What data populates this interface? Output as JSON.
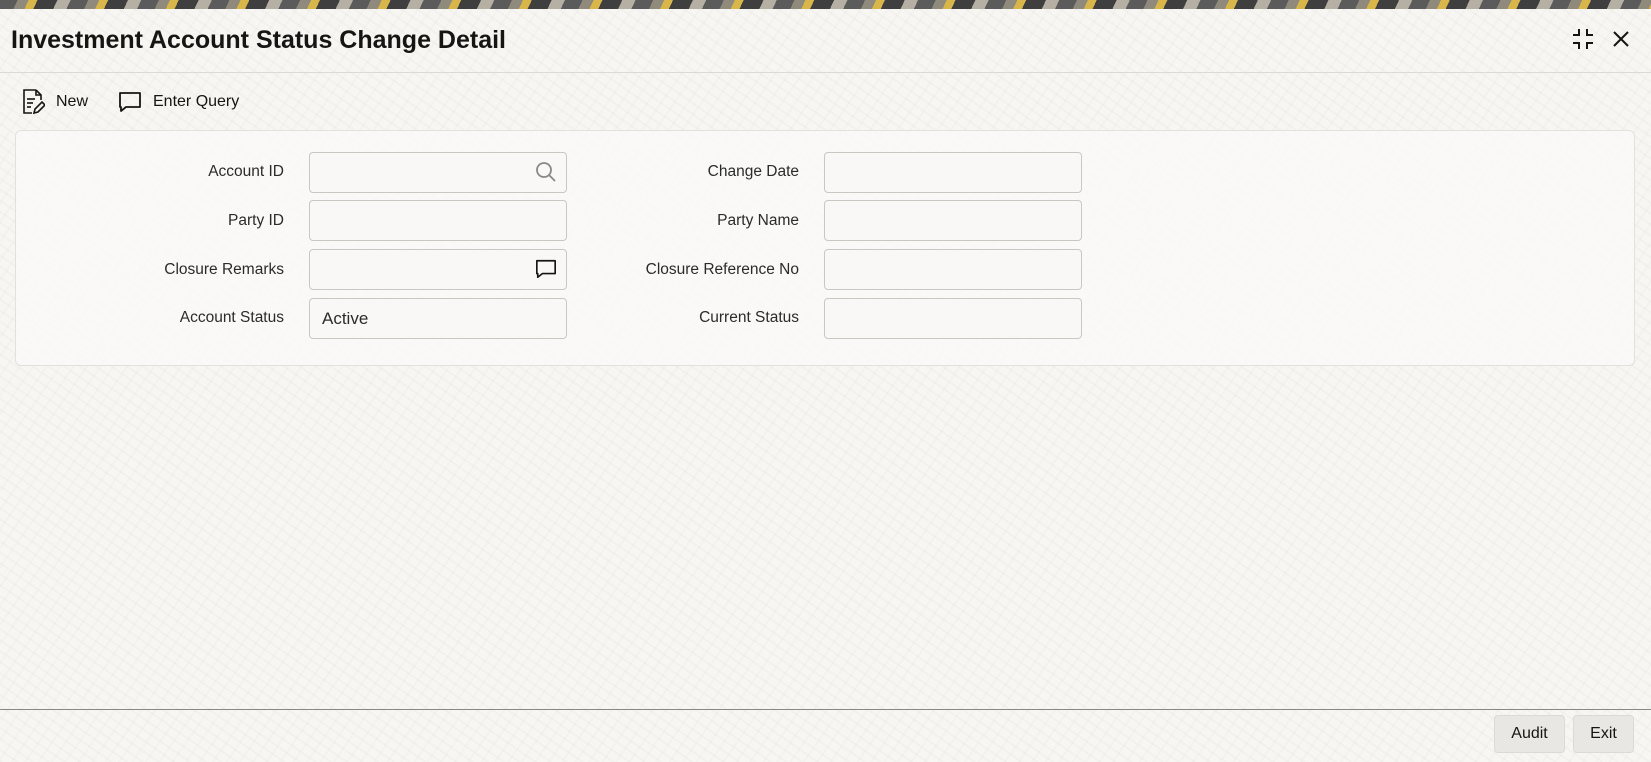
{
  "window": {
    "title": "Investment Account Status Change Detail",
    "controls": {
      "maximize_icon": "maximize-icon",
      "close_icon": "close-icon"
    }
  },
  "toolbar": {
    "new_label": "New",
    "new_icon": "document-edit-icon",
    "query_label": "Enter Query",
    "query_icon": "chat-bubble-icon"
  },
  "form": {
    "left": [
      {
        "label": "Account ID",
        "value": "",
        "icon": "search-icon"
      },
      {
        "label": "Party ID",
        "value": ""
      },
      {
        "label": "Closure Remarks",
        "value": "",
        "icon": "chat-bubble-icon"
      },
      {
        "label": "Account Status",
        "value": "Active"
      }
    ],
    "right": [
      {
        "label": "Change Date",
        "value": ""
      },
      {
        "label": "Party Name",
        "value": ""
      },
      {
        "label": "Closure Reference No",
        "value": ""
      },
      {
        "label": "Current Status",
        "value": ""
      }
    ]
  },
  "footer": {
    "audit_label": "Audit",
    "exit_label": "Exit"
  },
  "colors": {
    "background": "#f7f6f3",
    "field_border": "#c9c7c2",
    "button_bg": "#e9e7e3",
    "text": "#161513"
  }
}
